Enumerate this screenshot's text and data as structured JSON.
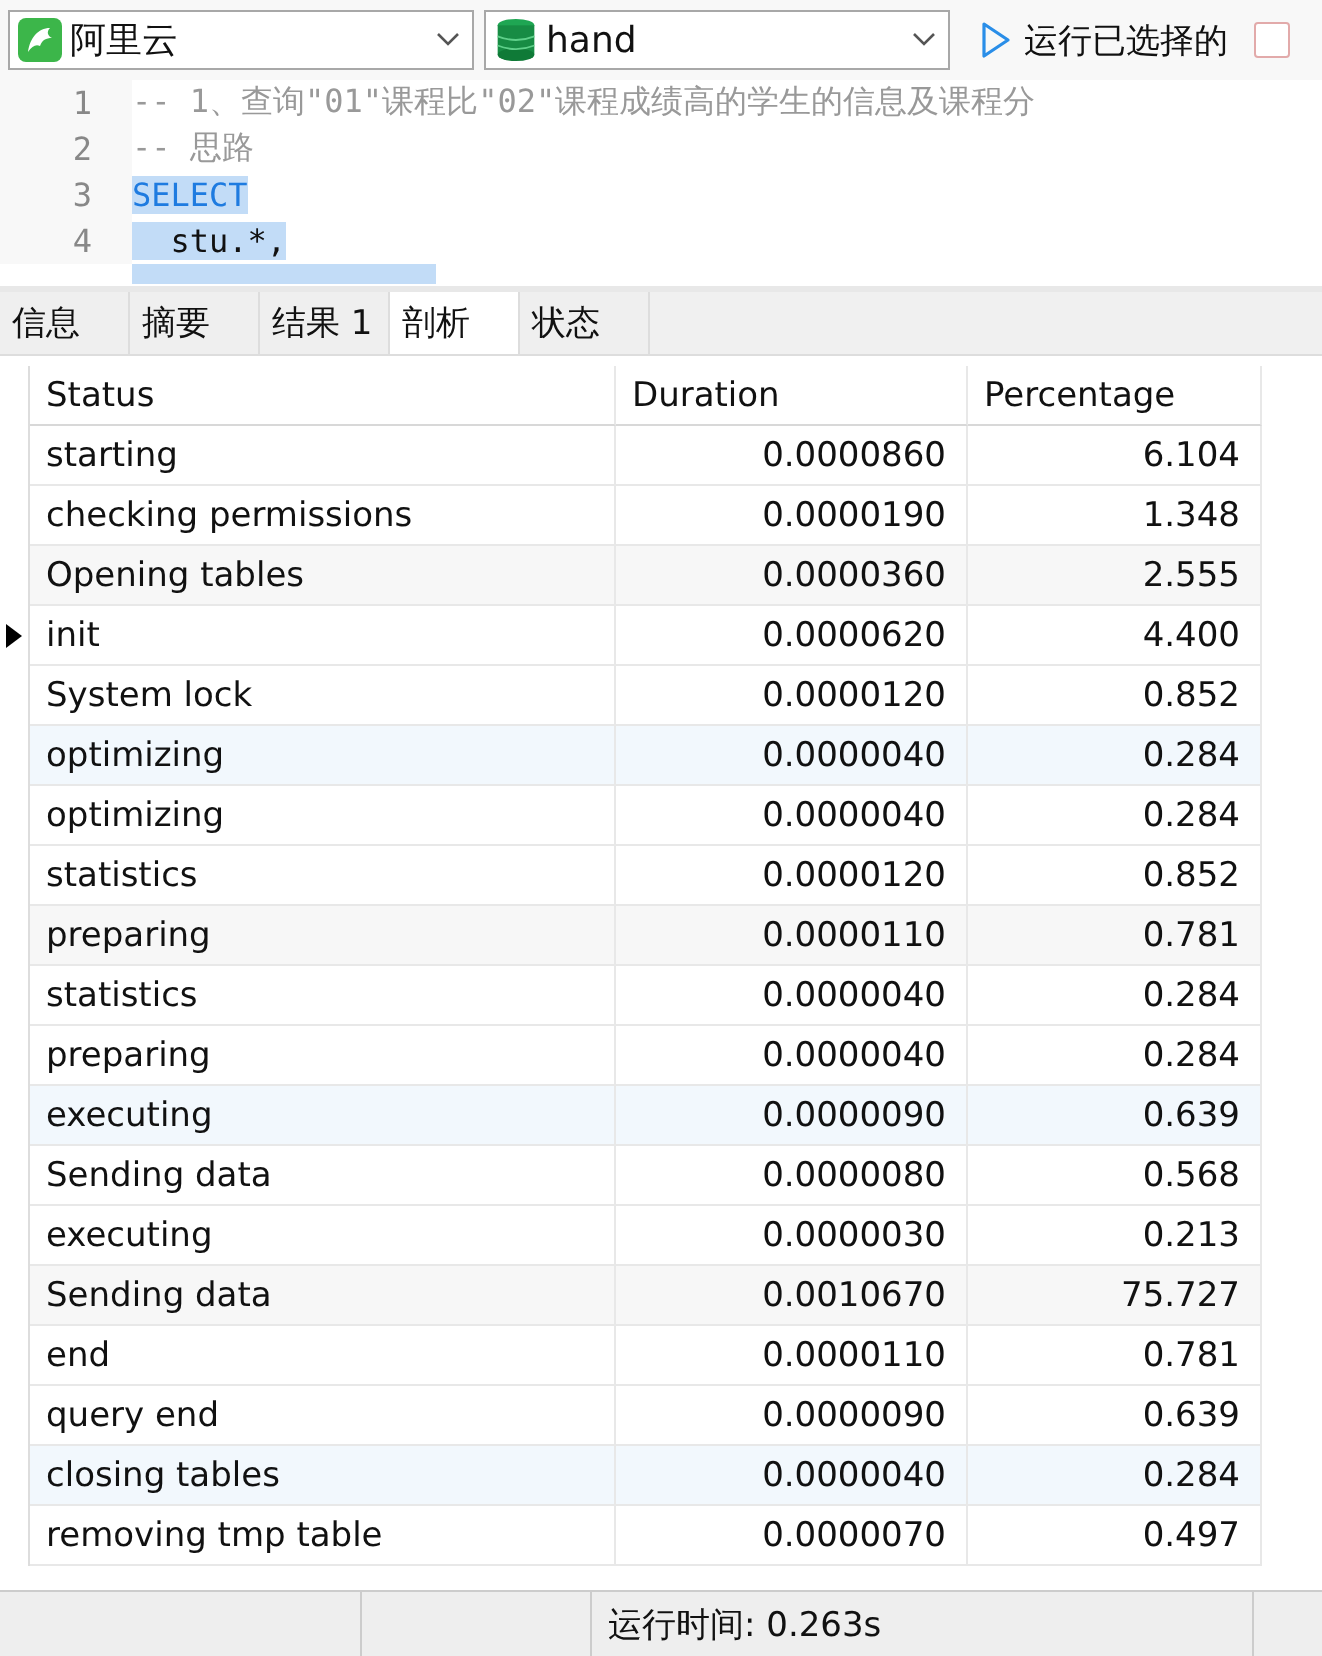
{
  "toolbar": {
    "connection": {
      "value": "阿里云"
    },
    "database": {
      "value": "hand"
    },
    "run_button": {
      "label": "运行已选择的"
    },
    "checkbox": {
      "checked": false
    }
  },
  "editor": {
    "lines": [
      {
        "number": "1",
        "text": "-- 1、查询\"01\"课程比\"02\"课程成绩高的学生的信息及课程分",
        "kind": "comment",
        "selected": false
      },
      {
        "number": "2",
        "text": "-- 思路",
        "kind": "comment",
        "selected": false
      },
      {
        "number": "3",
        "text": "SELECT",
        "kind": "keyword",
        "selected": true
      },
      {
        "number": "4",
        "text": "  stu.*,",
        "kind": "code",
        "selected": true
      }
    ]
  },
  "tabs": [
    {
      "label": "信息",
      "selected": false
    },
    {
      "label": "摘要",
      "selected": false
    },
    {
      "label": "结果 1",
      "selected": false
    },
    {
      "label": "剖析",
      "selected": true
    },
    {
      "label": "状态",
      "selected": false
    }
  ],
  "table": {
    "columns": [
      "Status",
      "Duration",
      "Percentage"
    ],
    "rows": [
      {
        "cells": [
          "starting",
          "0.0000860",
          "6.104"
        ],
        "current": false,
        "color": "#ffffff"
      },
      {
        "cells": [
          "checking permissions",
          "0.0000190",
          "1.348"
        ],
        "current": false,
        "color": "#ffffff"
      },
      {
        "cells": [
          "Opening tables",
          "0.0000360",
          "2.555"
        ],
        "current": false,
        "color": "#f7f7f7"
      },
      {
        "cells": [
          "init",
          "0.0000620",
          "4.400"
        ],
        "current": true,
        "color": "#ffffff"
      },
      {
        "cells": [
          "System lock",
          "0.0000120",
          "0.852"
        ],
        "current": false,
        "color": "#ffffff"
      },
      {
        "cells": [
          "optimizing",
          "0.0000040",
          "0.284"
        ],
        "current": false,
        "color": "#f2f8fd"
      },
      {
        "cells": [
          "optimizing",
          "0.0000040",
          "0.284"
        ],
        "current": false,
        "color": "#ffffff"
      },
      {
        "cells": [
          "statistics",
          "0.0000120",
          "0.852"
        ],
        "current": false,
        "color": "#ffffff"
      },
      {
        "cells": [
          "preparing",
          "0.0000110",
          "0.781"
        ],
        "current": false,
        "color": "#f7f7f7"
      },
      {
        "cells": [
          "statistics",
          "0.0000040",
          "0.284"
        ],
        "current": false,
        "color": "#ffffff"
      },
      {
        "cells": [
          "preparing",
          "0.0000040",
          "0.284"
        ],
        "current": false,
        "color": "#ffffff"
      },
      {
        "cells": [
          "executing",
          "0.0000090",
          "0.639"
        ],
        "current": false,
        "color": "#f2f8fd"
      },
      {
        "cells": [
          "Sending data",
          "0.0000080",
          "0.568"
        ],
        "current": false,
        "color": "#ffffff"
      },
      {
        "cells": [
          "executing",
          "0.0000030",
          "0.213"
        ],
        "current": false,
        "color": "#ffffff"
      },
      {
        "cells": [
          "Sending data",
          "0.0010670",
          "75.727"
        ],
        "current": false,
        "color": "#f7f7f7"
      },
      {
        "cells": [
          "end",
          "0.0000110",
          "0.781"
        ],
        "current": false,
        "color": "#ffffff"
      },
      {
        "cells": [
          "query end",
          "0.0000090",
          "0.639"
        ],
        "current": false,
        "color": "#ffffff"
      },
      {
        "cells": [
          "closing tables",
          "0.0000040",
          "0.284"
        ],
        "current": false,
        "color": "#f2f8fd"
      },
      {
        "cells": [
          "removing tmp table",
          "0.0000070",
          "0.497"
        ],
        "current": false,
        "color": "#ffffff"
      }
    ]
  },
  "status_bar": {
    "run_time": "运行时间: 0.263s"
  }
}
